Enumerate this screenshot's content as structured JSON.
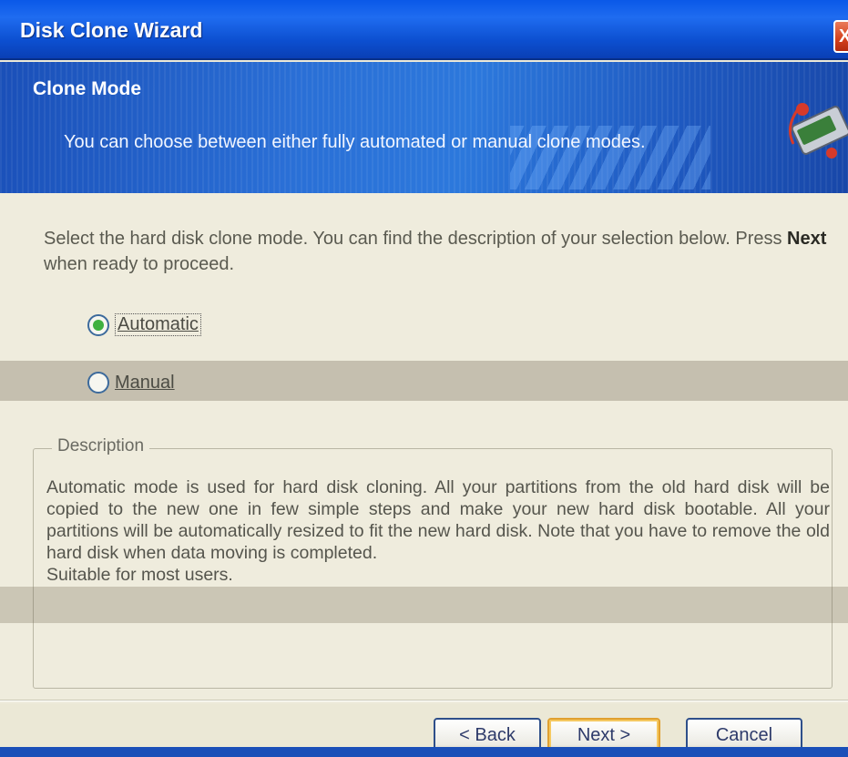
{
  "window": {
    "title": "Disk Clone Wizard",
    "close_label": "X"
  },
  "banner": {
    "title": "Clone Mode",
    "subtitle": "You can choose between either fully automated or manual clone modes."
  },
  "instructions": {
    "before": "Select the hard disk clone mode. You can find the description of your selection below. Press ",
    "bold": "Next",
    "after": " when ready to proceed."
  },
  "options": {
    "automatic": {
      "label": "Automatic",
      "selected": true
    },
    "manual": {
      "label": "Manual",
      "selected": false
    }
  },
  "description": {
    "legend": "Description",
    "text": "Automatic mode is used for hard disk cloning. All your partitions from the old hard disk will be copied to the new one in few simple steps and make your new hard disk bootable. All your partitions will be automatically resized to fit the new hard disk. Note that you have to remove the old hard disk when data moving is completed.",
    "note": "Suitable for most users."
  },
  "buttons": {
    "back": "< Back",
    "next": "Next >",
    "cancel": "Cancel"
  },
  "colors": {
    "titlebar": "#0a58e8",
    "banner": "#2a6fd6",
    "selected_radio": "#3fb040",
    "body": "#efecdd"
  }
}
